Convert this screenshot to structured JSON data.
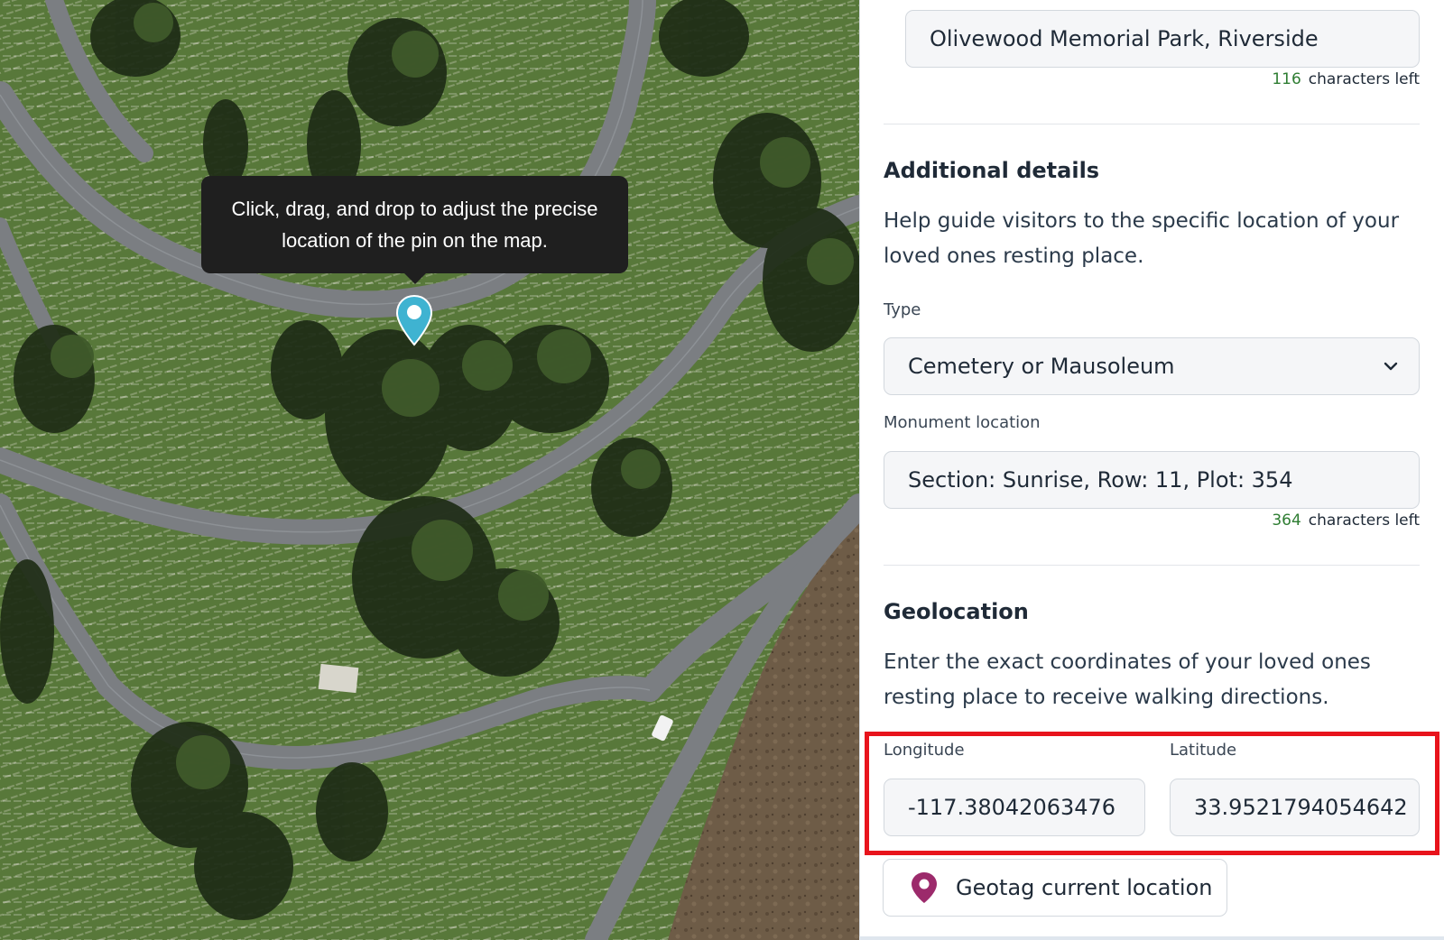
{
  "map": {
    "tooltip_text": "Click, drag, and drop to adjust the precise location of the pin on the map.",
    "pin_color": "#3fb3d1",
    "pin_icon": "map-pin-icon"
  },
  "form": {
    "place_name_value": "Olivewood Memorial Park, Riverside",
    "place_name_counter": {
      "count": "116",
      "suffix": "characters left"
    },
    "additional_details": {
      "title": "Additional details",
      "description": "Help guide visitors to the specific location of your loved ones resting place.",
      "type_label": "Type",
      "type_value": "Cemetery or Mausoleum",
      "type_icon": "chevron-down-icon",
      "monument_label": "Monument location",
      "monument_value": "Section: Sunrise, Row: 11, Plot: 354",
      "monument_counter": {
        "count": "364",
        "suffix": "characters left"
      }
    },
    "geolocation": {
      "title": "Geolocation",
      "description": "Enter the exact coordinates of your loved ones resting place to receive walking directions.",
      "longitude_label": "Longitude",
      "longitude_value": "-117.38042063476",
      "latitude_label": "Latitude",
      "latitude_value": "33.9521794054642",
      "geotag_button_label": "Geotag current location",
      "geotag_icon": "location-pin-icon",
      "geotag_icon_color": "#9c2a6b"
    }
  },
  "colors": {
    "counter_number": "#2e7d32",
    "highlight_border": "#e8141c",
    "tooltip_bg": "#1f1f1f"
  }
}
